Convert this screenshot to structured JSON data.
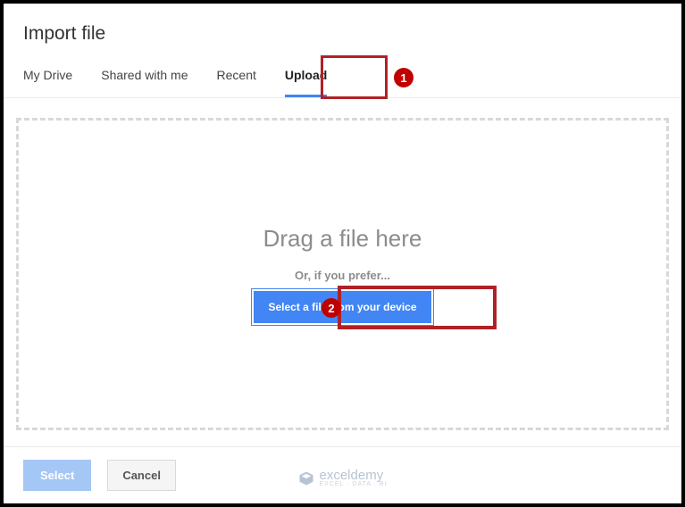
{
  "dialog": {
    "title": "Import file"
  },
  "tabs": {
    "myDrive": "My Drive",
    "sharedWithMe": "Shared with me",
    "recent": "Recent",
    "upload": "Upload"
  },
  "dropzone": {
    "dragText": "Drag a file here",
    "orText": "Or, if you prefer...",
    "selectButton": "Select a file from your device"
  },
  "footer": {
    "selectLabel": "Select",
    "cancelLabel": "Cancel"
  },
  "callouts": {
    "one": "1",
    "two": "2"
  },
  "watermark": {
    "brand": "exceldemy",
    "tagline": "EXCEL · DATA · BI"
  }
}
